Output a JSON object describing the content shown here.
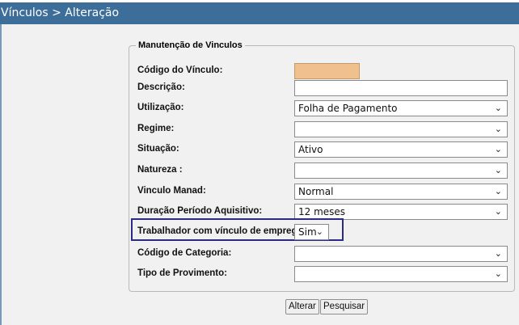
{
  "header": {
    "title": "Vínculos > Alteração"
  },
  "form": {
    "legend": "Manutenção de Vinculos",
    "fields": [
      {
        "label": "Código do Vínculo:",
        "value": ""
      },
      {
        "label": "Descrição:",
        "value": ""
      },
      {
        "label": "Utilização:",
        "value": "Folha de Pagamento"
      },
      {
        "label": "Regime:",
        "value": ""
      },
      {
        "label": "Situação:",
        "value": "Ativo"
      },
      {
        "label": "Natureza :",
        "value": ""
      },
      {
        "label": "Vinculo Manad:",
        "value": "Normal"
      },
      {
        "label": "Duração Período Aquisitivo:",
        "value": "12 meses"
      },
      {
        "label": "Trabalhador com vínculo de emprego:",
        "value": "Sim"
      },
      {
        "label": "Código de Categoria:",
        "value": ""
      },
      {
        "label": "Tipo de Provimento:",
        "value": ""
      }
    ]
  },
  "buttons": {
    "alterar": "Alterar",
    "pesquisar": "Pesquisar"
  },
  "icons": {
    "dropdown": "chevron-down-icon"
  },
  "colors": {
    "titlebar": "#3d6e99",
    "readonly_field": "#f0c08e",
    "highlight": "#2b2b84"
  }
}
